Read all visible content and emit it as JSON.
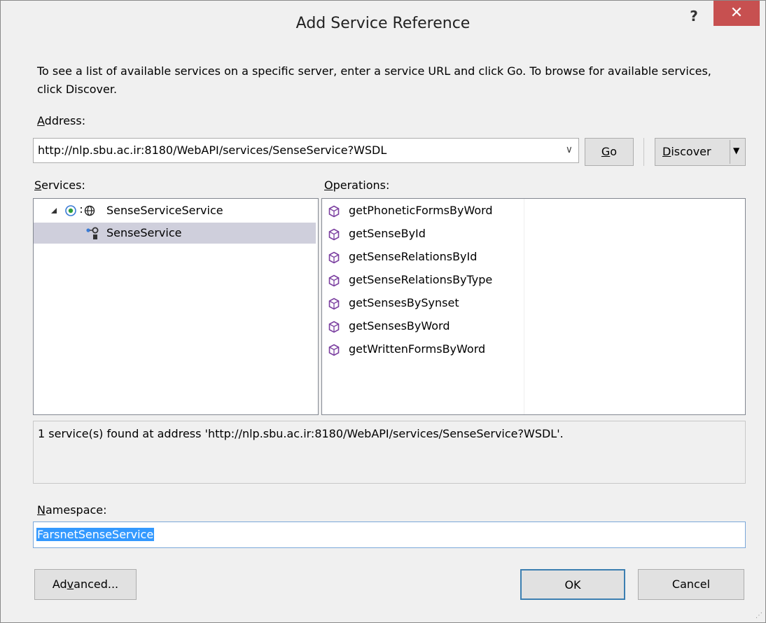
{
  "window": {
    "title": "Add Service Reference",
    "help": "?",
    "close": "✕"
  },
  "intro_text": "To see a list of available services on a specific server, enter a service URL and click Go. To browse for available services, click Discover.",
  "address": {
    "label_accel": "A",
    "label_rest": "ddress:",
    "value": "http://nlp.sbu.ac.ir:8180/WebAPI/services/SenseService?WSDL"
  },
  "buttons": {
    "go_accel": "G",
    "go_rest": "o",
    "discover_accel": "D",
    "discover_rest": "iscover",
    "advanced_pre": "Ad",
    "advanced_accel": "v",
    "advanced_post": "anced...",
    "ok": "OK",
    "cancel": "Cancel"
  },
  "services": {
    "label_accel": "S",
    "label_rest": "ervices:",
    "tree": [
      {
        "label": "SenseServiceService",
        "expanded": true
      },
      {
        "label": "SenseService",
        "selected": true
      }
    ]
  },
  "operations": {
    "label_accel": "O",
    "label_rest": "perations:",
    "items": [
      "getPhoneticFormsByWord",
      "getSenseById",
      "getSenseRelationsById",
      "getSenseRelationsByType",
      "getSensesBySynset",
      "getSensesByWord",
      "getWrittenFormsByWord"
    ]
  },
  "status": "1 service(s) found at address 'http://nlp.sbu.ac.ir:8180/WebAPI/services/SenseService?WSDL'.",
  "namespace": {
    "label_accel": "N",
    "label_rest": "amespace:",
    "value": "FarsnetSenseService"
  },
  "colors": {
    "selection": "#3399ff",
    "close": "#c75050",
    "tree_selected": "#cfcfdc",
    "op_icon": "#7b3fa0"
  }
}
